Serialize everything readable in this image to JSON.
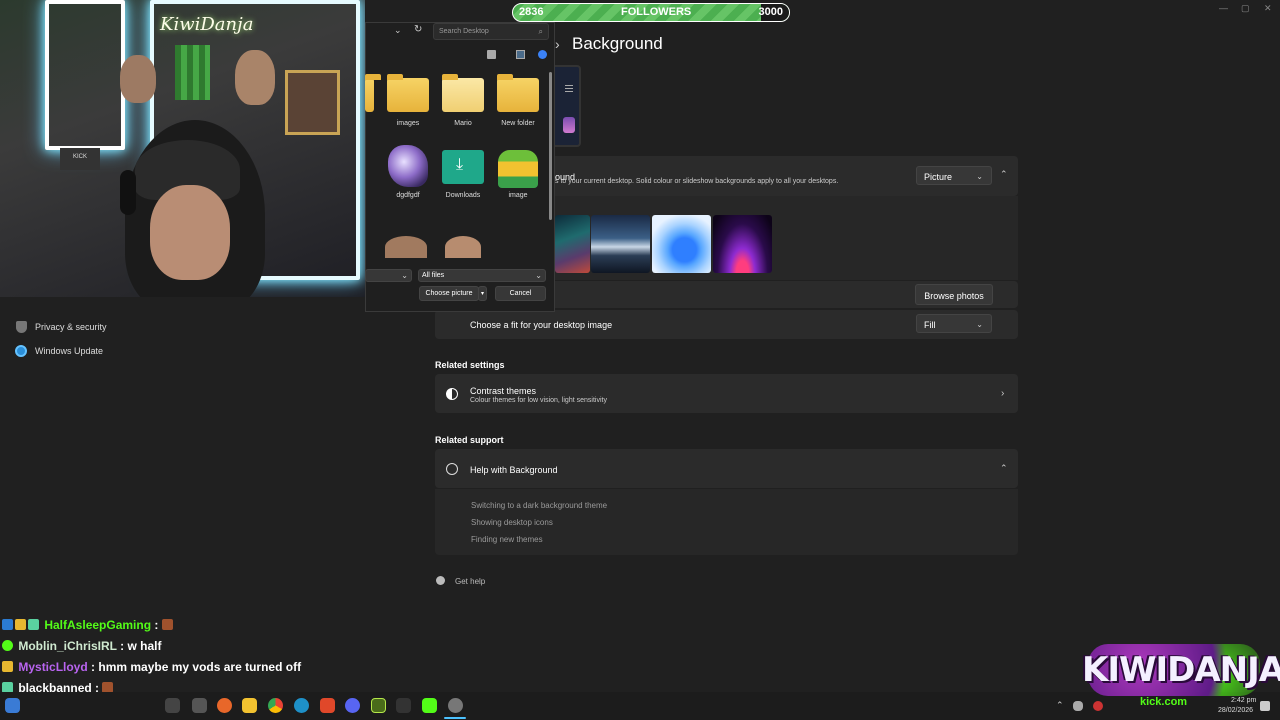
{
  "followers": {
    "current": "2836",
    "label": "FOLLOWERS",
    "goal": "3000",
    "progress": 0.9
  },
  "settings": {
    "page_title": "Background",
    "background_row": {
      "title": "ound",
      "desc": "s to your current desktop. Solid colour or slideshow backgrounds apply to all your desktops.",
      "dropdown_value": "Picture"
    },
    "browse_label": "Browse photos",
    "fit_label": "Choose a fit for your desktop image",
    "fit_value": "Fill",
    "related_settings_heading": "Related settings",
    "contrast_title": "Contrast themes",
    "contrast_desc": "Colour themes for low vision, light sensitivity",
    "related_support_heading": "Related support",
    "help_title": "Help with Background",
    "help_links": [
      "Switching to a dark background theme",
      "Showing desktop icons",
      "Finding new themes"
    ],
    "get_help": "Get help"
  },
  "sidebar": {
    "privacy": "Privacy & security",
    "update": "Windows Update"
  },
  "dialog": {
    "search_placeholder": "Search Desktop",
    "items_row1": [
      "images",
      "Mario",
      "New folder"
    ],
    "items_row2": [
      "dgdfgdf",
      "Downloads",
      "image"
    ],
    "file_type": "All files",
    "choose_label": "Choose picture",
    "cancel_label": "Cancel"
  },
  "chat": [
    {
      "user": "HalfAsleepGaming",
      "sep": " : ",
      "msg": "",
      "color": "#53fc18"
    },
    {
      "user": "Moblin_iChrisIRL",
      "sep": " : ",
      "msg": "w half",
      "color": "#cfe9cf"
    },
    {
      "user": "MysticLloyd",
      "sep": " : ",
      "msg": "hmm maybe my vods are turned off",
      "color": "#b964f0"
    },
    {
      "user": "blackbanned",
      "sep": " : ",
      "msg": "",
      "color": "#ffffff"
    },
    {
      "user": "HalfAsleepGaming",
      "sep": " : ",
      "msg": "",
      "color": "#53fc18"
    }
  ],
  "webcam": {
    "neon_sign": "KiwiDanja"
  },
  "taskbar": {
    "time": "2:42 pm",
    "date": "28/02/2026"
  },
  "logo": {
    "text": "KIWIDANJA",
    "sub": "kick.com"
  },
  "colors": {
    "accent": "#53fc18",
    "panel": "#2b2b2b",
    "background": "#202020"
  }
}
